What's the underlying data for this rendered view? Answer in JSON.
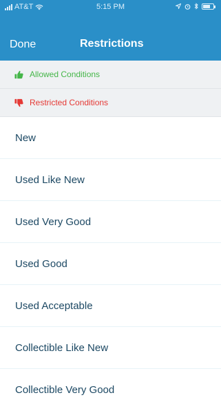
{
  "status_bar": {
    "carrier": "AT&T",
    "time": "5:15 PM"
  },
  "nav": {
    "done_label": "Done",
    "title": "Restrictions"
  },
  "legend": {
    "allowed": {
      "label": "Allowed Conditions",
      "icon": "thumbs-up-icon",
      "color": "#45b649"
    },
    "restricted": {
      "label": "Restricted Conditions",
      "icon": "thumbs-down-icon",
      "color": "#e53935"
    }
  },
  "conditions": [
    {
      "label": "New"
    },
    {
      "label": "Used Like New"
    },
    {
      "label": "Used Very Good"
    },
    {
      "label": "Used Good"
    },
    {
      "label": "Used Acceptable"
    },
    {
      "label": "Collectible Like New"
    },
    {
      "label": "Collectible Very Good"
    }
  ],
  "colors": {
    "nav_background": "#2a8fc8",
    "legend_background": "#eff1f3",
    "item_text": "#1c4863"
  }
}
